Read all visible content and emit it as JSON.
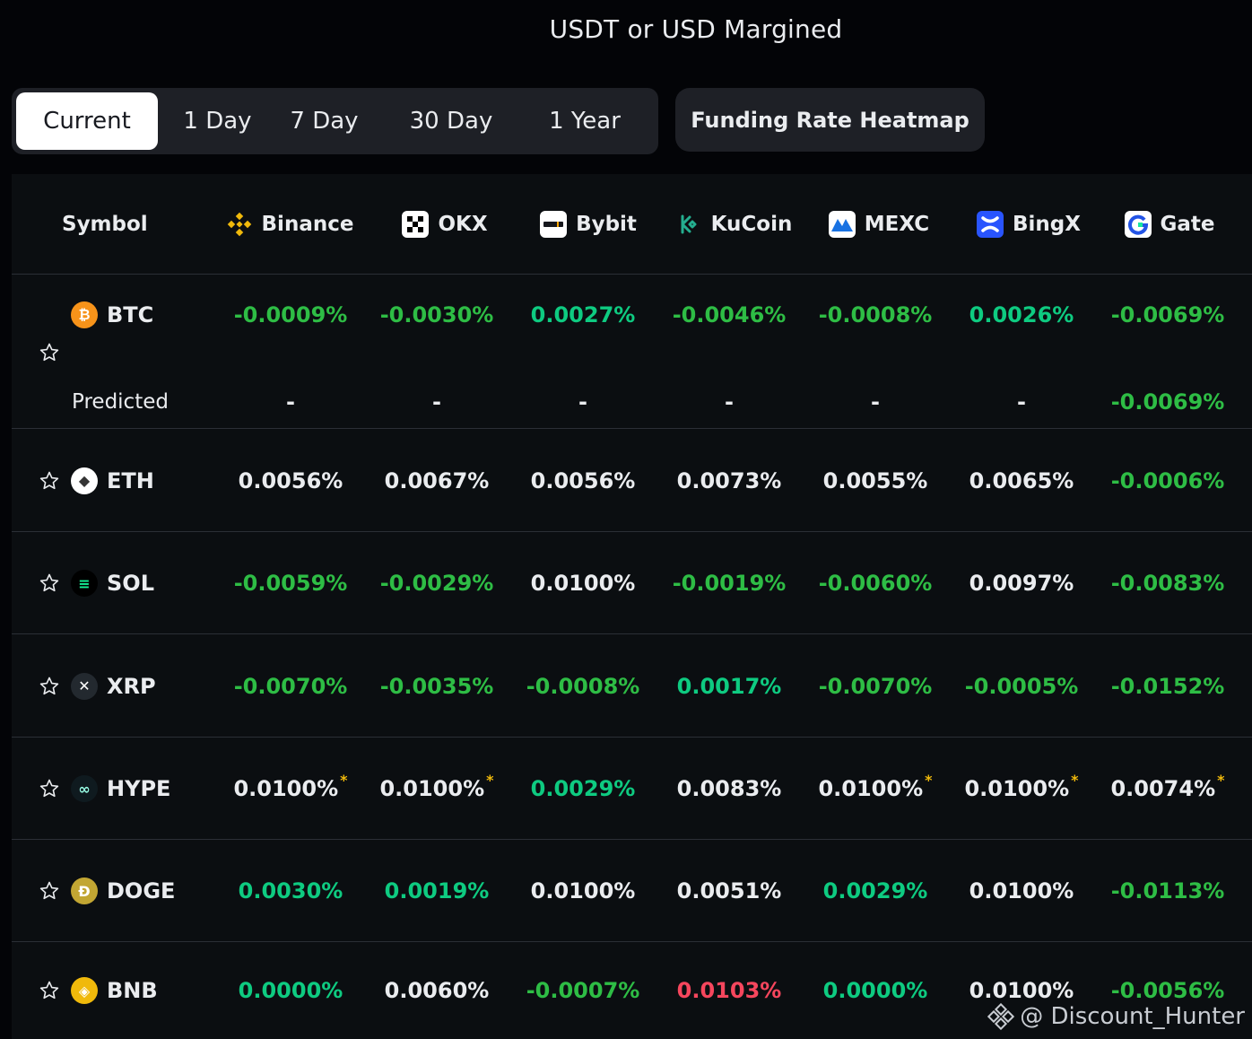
{
  "title": "USDT or USD Margined",
  "tabs": [
    "Current",
    "1 Day",
    "7 Day",
    "30 Day",
    "1 Year"
  ],
  "heatmap_button": "Funding Rate Heatmap",
  "columns": {
    "symbol": "Symbol",
    "exchanges": [
      "Binance",
      "OKX",
      "Bybit",
      "KuCoin",
      "MEXC",
      "BingX",
      "Gate"
    ]
  },
  "predicted_label": "Predicted",
  "rows": [
    {
      "symbol": "BTC",
      "rates": [
        "-0.0009%",
        "-0.0030%",
        "0.0027%",
        "-0.0046%",
        "-0.0008%",
        "0.0026%",
        "-0.0069%"
      ],
      "predicted": [
        "-",
        "-",
        "-",
        "-",
        "-",
        "-",
        "-0.0069%"
      ]
    },
    {
      "symbol": "ETH",
      "rates": [
        "0.0056%",
        "0.0067%",
        "0.0056%",
        "0.0073%",
        "0.0055%",
        "0.0065%",
        "-0.0006%"
      ]
    },
    {
      "symbol": "SOL",
      "rates": [
        "-0.0059%",
        "-0.0029%",
        "0.0100%",
        "-0.0019%",
        "-0.0060%",
        "0.0097%",
        "-0.0083%"
      ]
    },
    {
      "symbol": "XRP",
      "rates": [
        "-0.0070%",
        "-0.0035%",
        "-0.0008%",
        "0.0017%",
        "-0.0070%",
        "-0.0005%",
        "-0.0152%"
      ]
    },
    {
      "symbol": "HYPE",
      "rates": [
        "0.0100%",
        "0.0100%",
        "0.0029%",
        "0.0083%",
        "0.0100%",
        "0.0100%",
        "0.0074%"
      ]
    },
    {
      "symbol": "DOGE",
      "rates": [
        "0.0030%",
        "0.0019%",
        "0.0100%",
        "0.0051%",
        "0.0029%",
        "0.0100%",
        "-0.0113%"
      ]
    },
    {
      "symbol": "BNB",
      "rates": [
        "0.0000%",
        "0.0060%",
        "-0.0007%",
        "0.0103%",
        "0.0000%",
        "0.0100%",
        "-0.0056%"
      ]
    }
  ],
  "asterisk": "*",
  "colors": {
    "positive": "#0ecb81",
    "negative": "#2ebd45",
    "neutral": "#eaecef",
    "alert": "#f6465d",
    "accent": "#f0b90b"
  },
  "watermark": "@ Discount_Hunter"
}
